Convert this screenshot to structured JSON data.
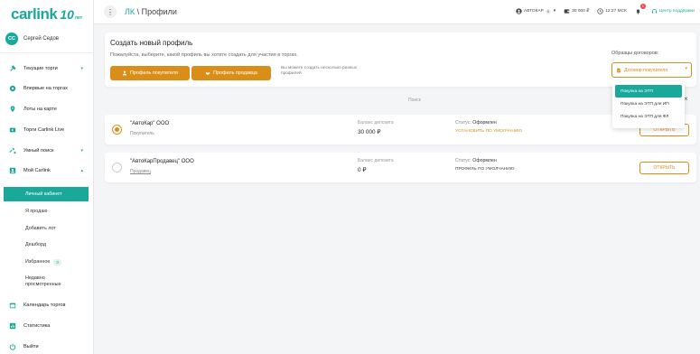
{
  "brand": {
    "logo": "carlink",
    "anniversary": "10",
    "anniversary_suffix": "лет",
    "accent": "#1aa89a",
    "orange": "#d98e1a"
  },
  "user": {
    "initials": "СС",
    "name": "Сергей Седов"
  },
  "sidebar": {
    "items": [
      {
        "label": "Текущие торги",
        "icon": "gavel-icon",
        "expandable": true
      },
      {
        "label": "Впервые на торгах",
        "icon": "star-badge-icon"
      },
      {
        "label": "Лоты на карте",
        "icon": "map-pin-icon"
      },
      {
        "label": "Торги Carlink Live",
        "icon": "live-icon"
      },
      {
        "label": "Умный поиск",
        "icon": "smart-search-icon",
        "expandable": true
      },
      {
        "label": "Мой Carlink",
        "icon": "account-icon",
        "expandable": true
      }
    ],
    "subitems": [
      {
        "label": "Личный кабинет",
        "active": true
      },
      {
        "label": "Я продаю"
      },
      {
        "label": "Добавить лот"
      },
      {
        "label": "Дешборд"
      },
      {
        "label": "Избранное",
        "badge": "0"
      },
      {
        "label": "Недавно просмотренные"
      }
    ],
    "bottom_items": [
      {
        "label": "Календарь торгов",
        "icon": "calendar-icon"
      },
      {
        "label": "Статистика",
        "icon": "chart-icon"
      },
      {
        "label": "Выйти",
        "icon": "power-icon"
      }
    ]
  },
  "header": {
    "breadcrumb_root": "ЛК",
    "breadcrumb_sep": " \\ ",
    "breadcrumb_page": "Профили",
    "account": "АВТОКАР",
    "account_count": "0",
    "balance": "30 000 ₽",
    "time": "12:27 МСК",
    "notifications": "1",
    "support": "Центр поддержки"
  },
  "create": {
    "title": "Создать новый профиль",
    "description": "Пожалуйста, выберите, какой профиль вы хотите создать для участия в торгах.",
    "buyer_button": "Профиль покупателя",
    "seller_button": "Профиль продавца",
    "hint": "Вы можете создать несколько разных профилей",
    "templates_label": "Образцы договоров:",
    "contract_select": "Договор покупателя"
  },
  "dropdown": {
    "options": [
      "Покупка на ЭТП",
      "Покупка на ЭТП для ИП",
      "Покупка на ЭТП для ФЛ"
    ],
    "selected_index": 0
  },
  "search_label": "Поиск",
  "profiles": [
    {
      "name": "\"АвтоКар\" ООО",
      "type": "Покупатель",
      "deposit_label": "Баланс депозита",
      "deposit": "30 000 ₽",
      "status_label": "Статус:",
      "status": "Оформлен",
      "default_text": "УСТАНОВИТЬ ПО УМОЛЧАНИЮ",
      "selected": true,
      "open_label": "ОТКРЫТЬ"
    },
    {
      "name": "\"АвтоКарПродавец\" ООО",
      "type": "Продавец",
      "deposit_label": "Баланс депозита",
      "deposit": "0 ₽",
      "status_label": "Статус:",
      "status": "Оформлен",
      "default_text": "ПРОФИЛЬ ПО УМОЛЧАНИЮ",
      "selected": false,
      "open_label": "ОТКРЫТЬ"
    }
  ]
}
